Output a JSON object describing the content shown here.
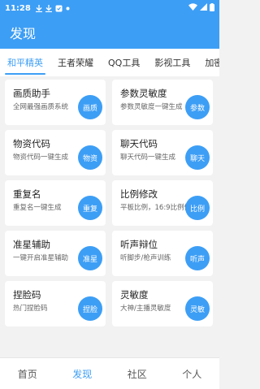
{
  "status": {
    "time": "11:28"
  },
  "app_bar": {
    "title": "发现"
  },
  "tabs": [
    {
      "label": "和平精英"
    },
    {
      "label": "王者荣耀"
    },
    {
      "label": "QQ工具"
    },
    {
      "label": "影视工具"
    },
    {
      "label": "加密工"
    }
  ],
  "cards": [
    {
      "title": "画质助手",
      "desc": "全网最强画质系统",
      "btn": "画质"
    },
    {
      "title": "参数灵敏度",
      "desc": "参数灵敏度一键生成",
      "btn": "参数"
    },
    {
      "title": "物资代码",
      "desc": "物资代码一键生成",
      "btn": "物资"
    },
    {
      "title": "聊天代码",
      "desc": "聊天代码一键生成",
      "btn": "聊天"
    },
    {
      "title": "重复名",
      "desc": "重复名一键生成",
      "btn": "重复"
    },
    {
      "title": "比例修改",
      "desc": "平板比例，16:9比例修改",
      "btn": "比例"
    },
    {
      "title": "准星辅助",
      "desc": "一键开启准星辅助",
      "btn": "准星"
    },
    {
      "title": "听声辩位",
      "desc": "听脚步/枪声训练",
      "btn": "听声"
    },
    {
      "title": "捏脸码",
      "desc": "热门捏脸码",
      "btn": "捏脸"
    },
    {
      "title": "灵敏度",
      "desc": "大神/主播灵敏度",
      "btn": "灵敏"
    }
  ],
  "bottom_nav": [
    {
      "label": "首页"
    },
    {
      "label": "发现"
    },
    {
      "label": "社区"
    },
    {
      "label": "个人"
    }
  ],
  "colors": {
    "accent": "#3d9ef5",
    "background": "#f2f2f2"
  }
}
